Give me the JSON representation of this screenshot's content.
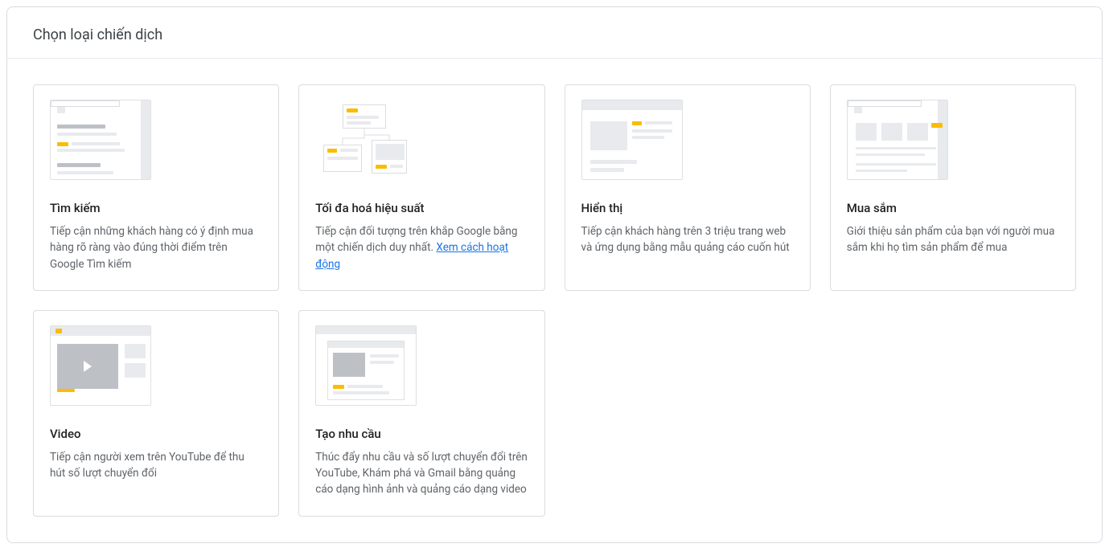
{
  "header": {
    "title": "Chọn loại chiến dịch"
  },
  "cards": {
    "search": {
      "title": "Tìm kiếm",
      "desc": "Tiếp cận những khách hàng có ý định mua hàng rõ ràng vào đúng thời điểm trên Google Tìm kiếm"
    },
    "pmax": {
      "title": "Tối đa hoá hiệu suất",
      "desc_prefix": "Tiếp cận đối tượng trên khắp Google bằng một chiến dịch duy nhất. ",
      "link": "Xem cách hoạt động"
    },
    "display": {
      "title": "Hiển thị",
      "desc": "Tiếp cận khách hàng trên 3 triệu trang web và ứng dụng bằng mẫu quảng cáo cuốn hút"
    },
    "shopping": {
      "title": "Mua sắm",
      "desc": "Giới thiệu sản phẩm của bạn với người mua sắm khi họ tìm sản phẩm để mua"
    },
    "video": {
      "title": "Video",
      "desc": "Tiếp cận người xem trên YouTube để thu hút số lượt chuyển đổi"
    },
    "demand": {
      "title": "Tạo nhu cầu",
      "desc": "Thúc đẩy nhu cầu và số lượt chuyển đổi trên YouTube, Khám phá và Gmail bằng quảng cáo dạng hình ảnh và quảng cáo dạng video"
    }
  }
}
